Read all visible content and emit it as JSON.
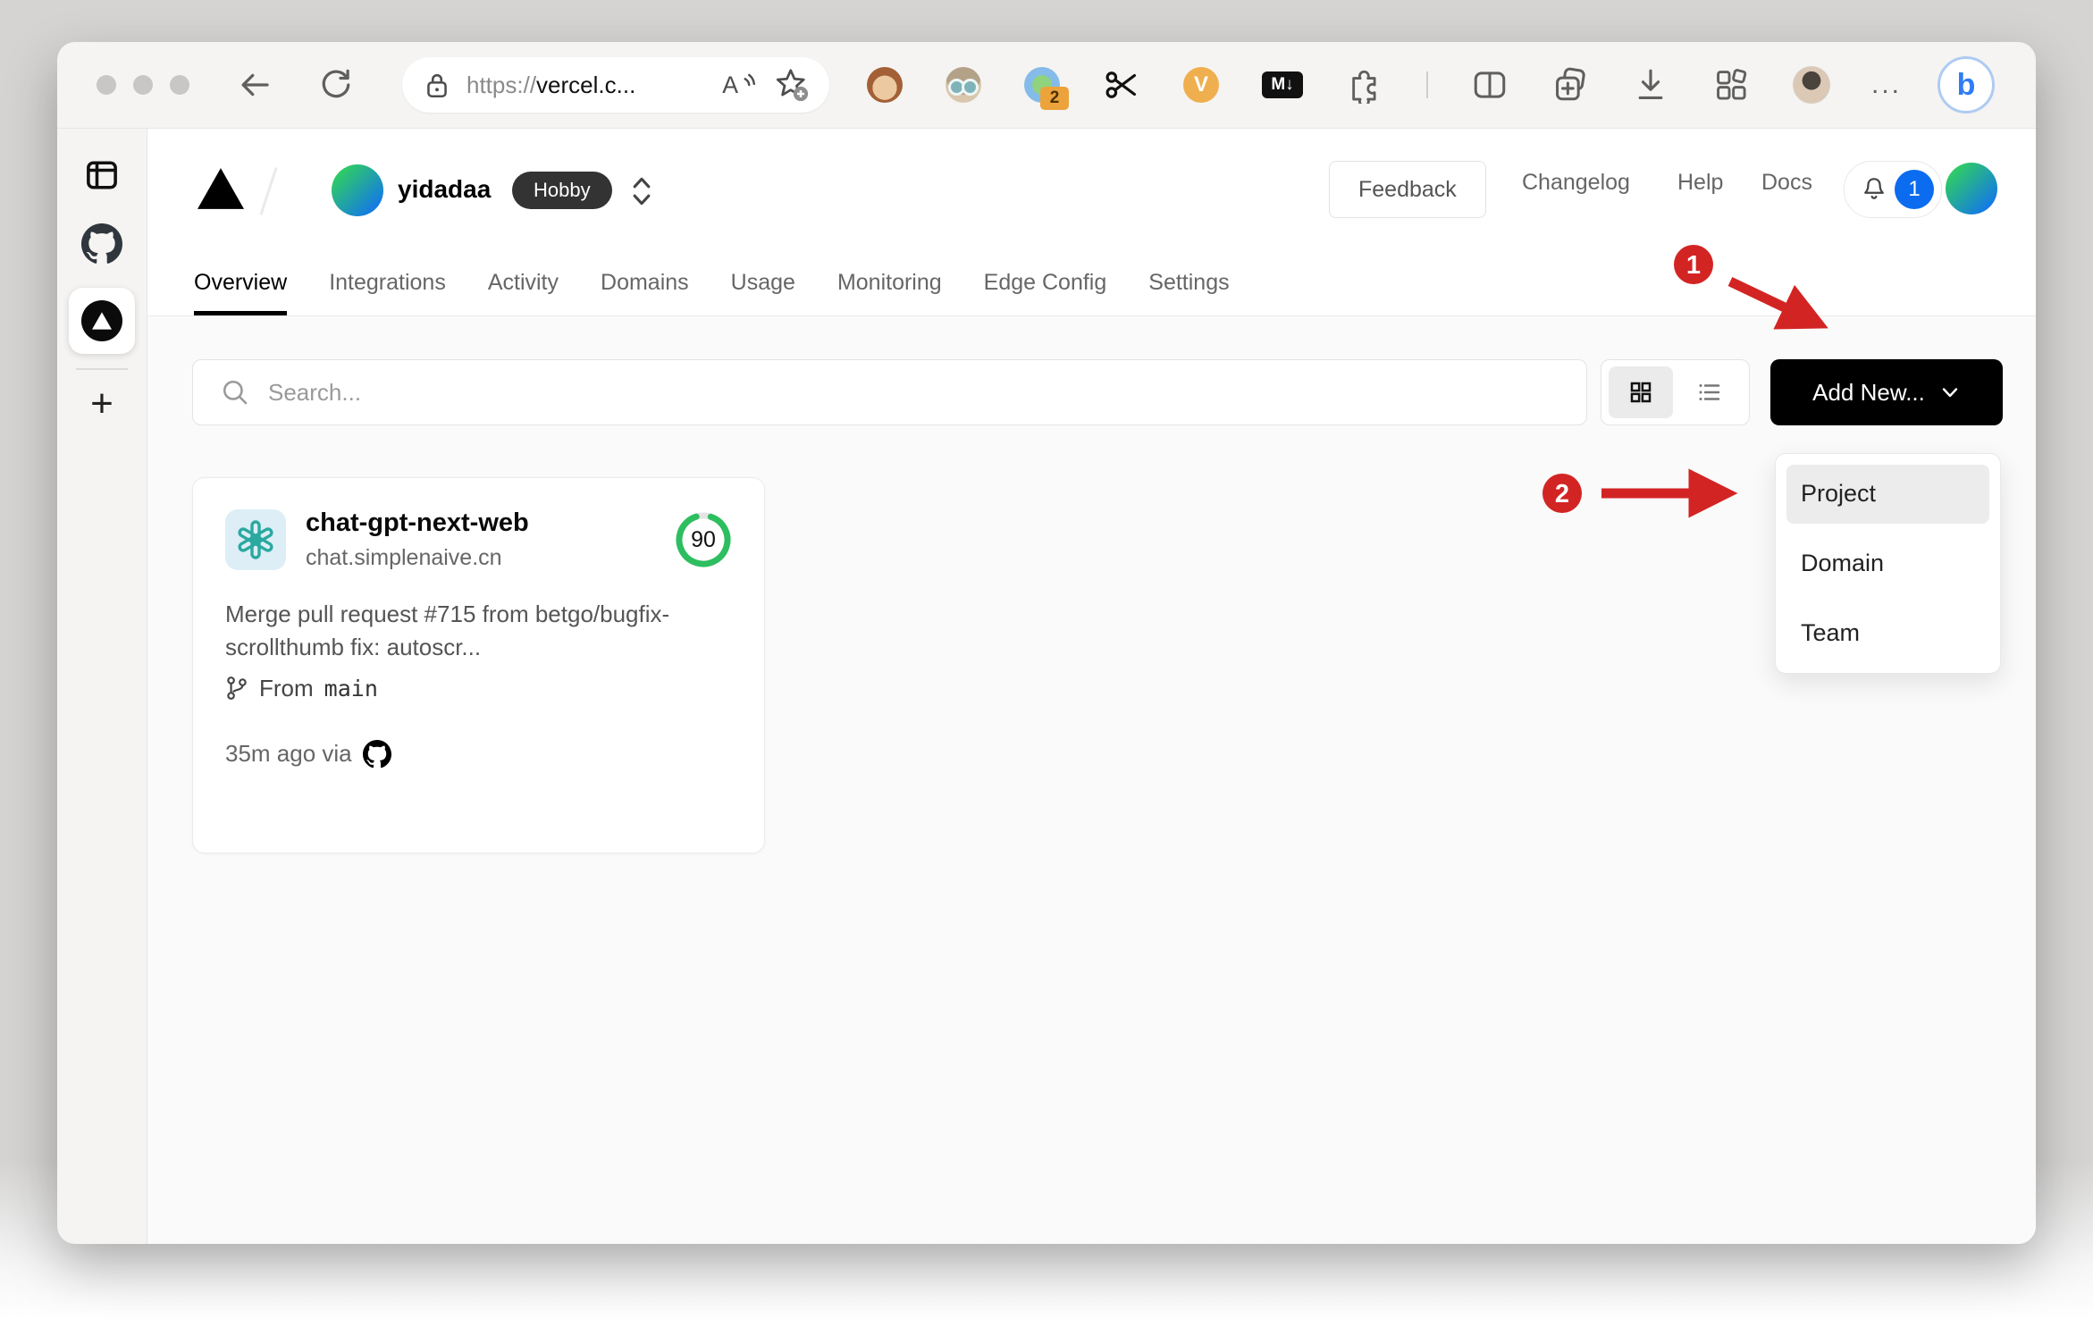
{
  "browser": {
    "url_scheme": "https://",
    "url_host": "vercel.c...",
    "translate_badge": "2",
    "v_extension_label": "V",
    "markdown_extension_label": "M↓",
    "more_label": "...",
    "bing_label": "b"
  },
  "vercel_header": {
    "team_name": "yidadaa",
    "plan_badge": "Hobby",
    "feedback_label": "Feedback",
    "changelog_label": "Changelog",
    "help_label": "Help",
    "docs_label": "Docs",
    "notification_count": "1"
  },
  "tabs": [
    {
      "label": "Overview",
      "active": true
    },
    {
      "label": "Integrations"
    },
    {
      "label": "Activity"
    },
    {
      "label": "Domains"
    },
    {
      "label": "Usage"
    },
    {
      "label": "Monitoring"
    },
    {
      "label": "Edge Config"
    },
    {
      "label": "Settings"
    }
  ],
  "controls": {
    "search_placeholder": "Search...",
    "add_new_label": "Add New..."
  },
  "project_card": {
    "name": "chat-gpt-next-web",
    "domain": "chat.simplenaive.cn",
    "score": "90",
    "commit_message": "Merge pull request #715 from betgo/bugfix-scrollthumb fix: autoscr...",
    "branch_label": "From",
    "branch_name": "main",
    "deploy_meta": "35m ago via"
  },
  "dropdown": {
    "items": [
      {
        "label": "Project",
        "highlighted": true
      },
      {
        "label": "Domain"
      },
      {
        "label": "Team"
      }
    ]
  },
  "annotations": {
    "step_1": "1",
    "step_2": "2",
    "color": "#d32424"
  },
  "colors": {
    "score_green": "#2dbe60",
    "notification_blue": "#0b6cf0",
    "button_black": "#000000"
  }
}
